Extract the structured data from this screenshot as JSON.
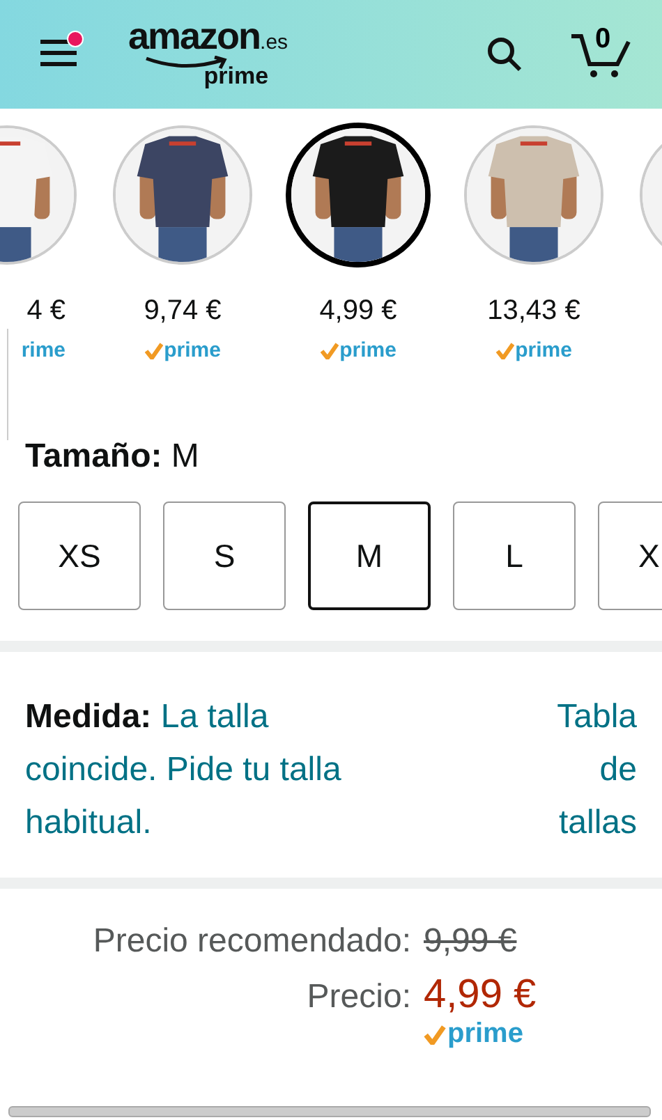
{
  "header": {
    "logo": "amazon",
    "logo_domain": ".es",
    "logo_sub": "prime",
    "menu_notification": true,
    "cart_count": "0"
  },
  "swatches": [
    {
      "color": "#f4f4f4",
      "price": "4 €",
      "prime": "rime",
      "selected": false,
      "partial": true
    },
    {
      "color": "#3c4563",
      "price": "9,74 €",
      "prime": "prime",
      "selected": false,
      "partial": false
    },
    {
      "color": "#1b1b1b",
      "price": "4,99 €",
      "prime": "prime",
      "selected": true,
      "partial": false
    },
    {
      "color": "#cdbfae",
      "price": "13,43 €",
      "prime": "prime",
      "selected": false,
      "partial": false
    },
    {
      "color": "#f4f4f4",
      "selected": false
    }
  ],
  "size": {
    "label": "**Tamaño:** M",
    "options": [
      {
        "label": "XS",
        "selected": false,
        "partial": false
      },
      {
        "label": "S",
        "selected": false,
        "partial": false
      },
      {
        "label": "M",
        "selected": true,
        "partial": false
      },
      {
        "label": "L",
        "selected": false,
        "partial": false
      },
      {
        "label": "X",
        "selected": false,
        "partial": true
      }
    ]
  },
  "fit": {
    "text": "**Medida:** La talla coincide. Pide tu talla habitual.",
    "link": "Tabla de tallas"
  },
  "pricing": {
    "list_label": "Precio recomendado:",
    "list_price": "9,99 €",
    "price_label": "Precio:",
    "price": "4,99 €",
    "prime": "prime"
  }
}
